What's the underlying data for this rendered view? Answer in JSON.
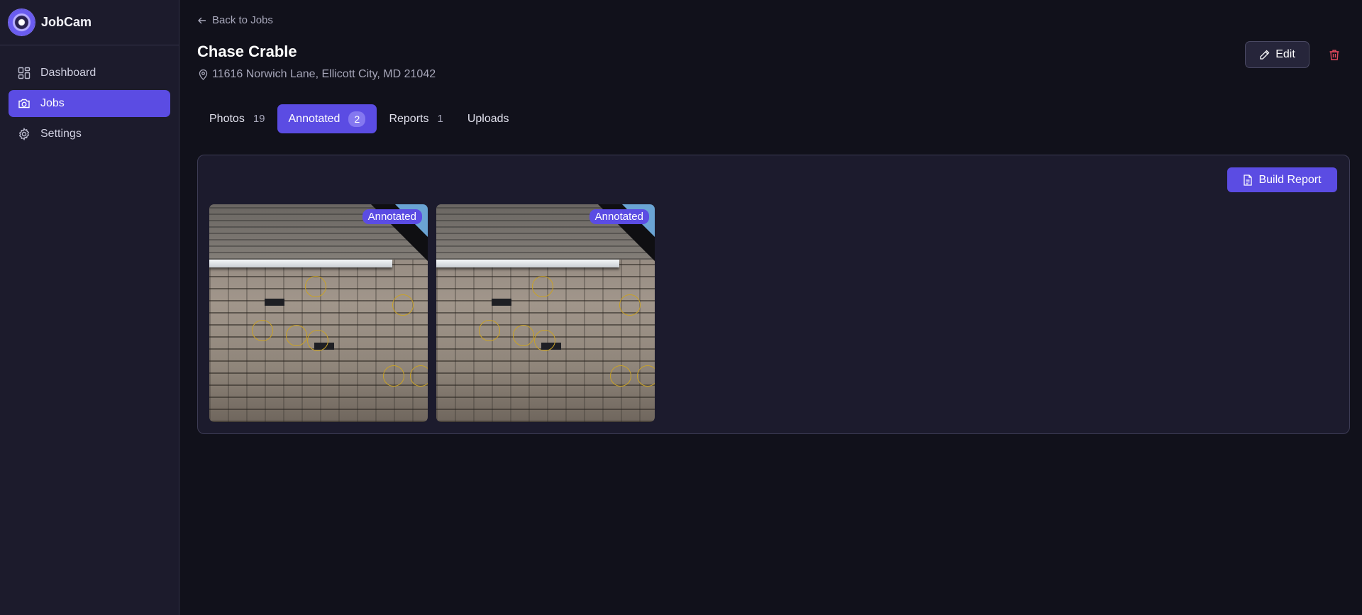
{
  "app": {
    "name": "JobCam"
  },
  "sidebar": {
    "items": [
      {
        "label": "Dashboard",
        "icon": "dashboard-icon",
        "active": false
      },
      {
        "label": "Jobs",
        "icon": "camera-icon",
        "active": true
      },
      {
        "label": "Settings",
        "icon": "gear-icon",
        "active": false
      }
    ]
  },
  "header": {
    "back_label": "Back to Jobs",
    "title": "Chase Crable",
    "address": "11616 Norwich Lane, Ellicott City, MD 21042",
    "edit_label": "Edit"
  },
  "tabs": [
    {
      "label": "Photos",
      "count": "19",
      "active": false
    },
    {
      "label": "Annotated",
      "count": "2",
      "active": true
    },
    {
      "label": "Reports",
      "count": "1",
      "active": false
    },
    {
      "label": "Uploads",
      "count": "",
      "active": false
    }
  ],
  "panel": {
    "build_report_label": "Build Report",
    "photos": [
      {
        "badge": "Annotated"
      },
      {
        "badge": "Annotated"
      }
    ]
  },
  "colors": {
    "accent": "#5b4ce3",
    "background": "#11111b",
    "sidebar": "#1c1b2c",
    "delete": "#e0485c"
  }
}
